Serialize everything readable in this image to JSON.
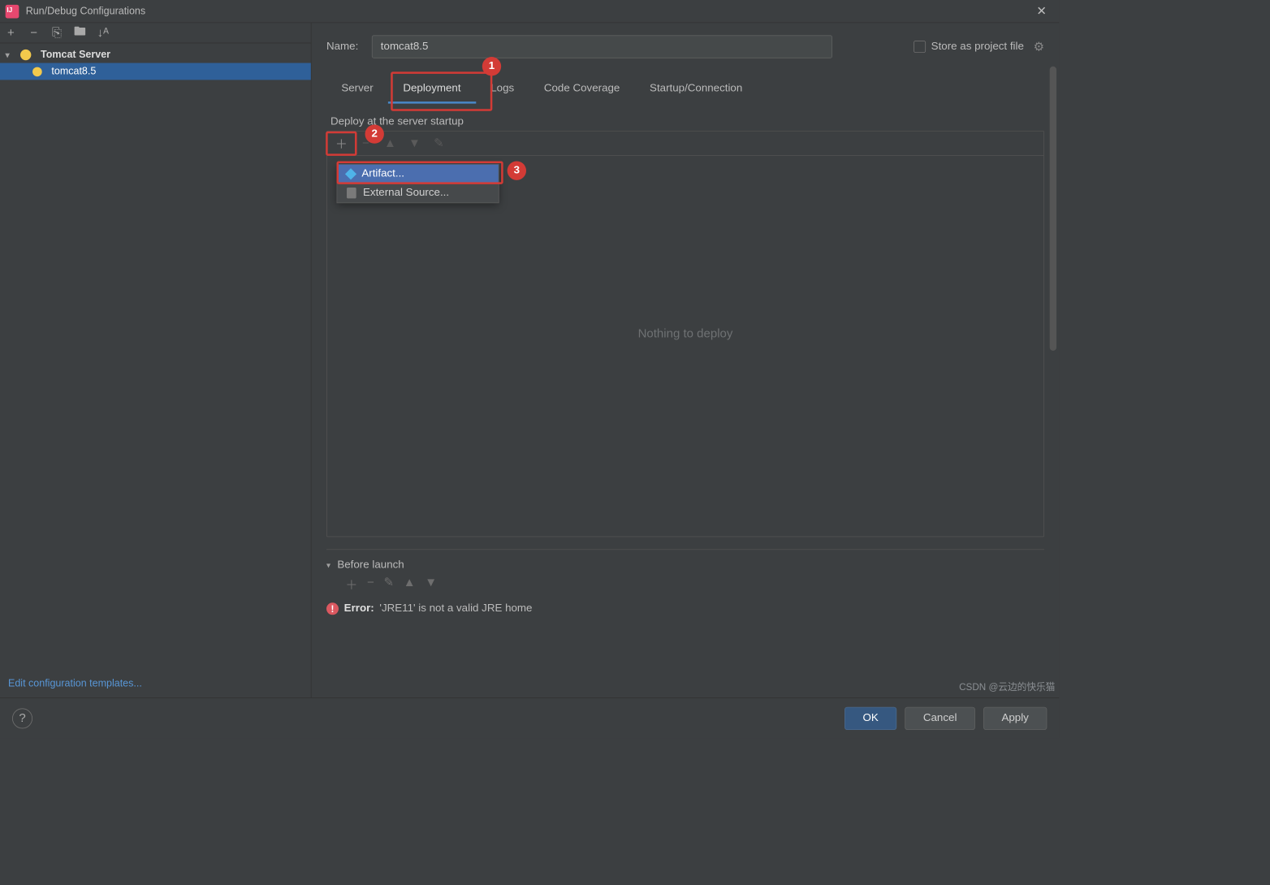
{
  "title": "Run/Debug Configurations",
  "tree": {
    "parent_label": "Tomcat Server",
    "child_label": "tomcat8.5"
  },
  "left_toolbar": {
    "add": "+",
    "remove": "−",
    "copy": "⎘",
    "save": "🖿",
    "sort": "↓ᴬ"
  },
  "edit_templates": "Edit configuration templates...",
  "name_label": "Name:",
  "name_value": "tomcat8.5",
  "store_label": "Store as project file",
  "tabs": [
    "Server",
    "Deployment",
    "Logs",
    "Code Coverage",
    "Startup/Connection"
  ],
  "active_tab": 1,
  "deploy_section_title": "Deploy at the server startup",
  "deploy_placeholder": "Nothing to deploy",
  "dropdown": {
    "artifact": "Artifact...",
    "external": "External Source..."
  },
  "before_launch_label": "Before launch",
  "error_label": "Error:",
  "error_message": "'JRE11' is not a valid JRE home",
  "buttons": {
    "ok": "OK",
    "cancel": "Cancel",
    "apply": "Apply"
  },
  "callouts": {
    "c1": "1",
    "c2": "2",
    "c3": "3"
  },
  "watermark": "CSDN @云边的快乐猫"
}
